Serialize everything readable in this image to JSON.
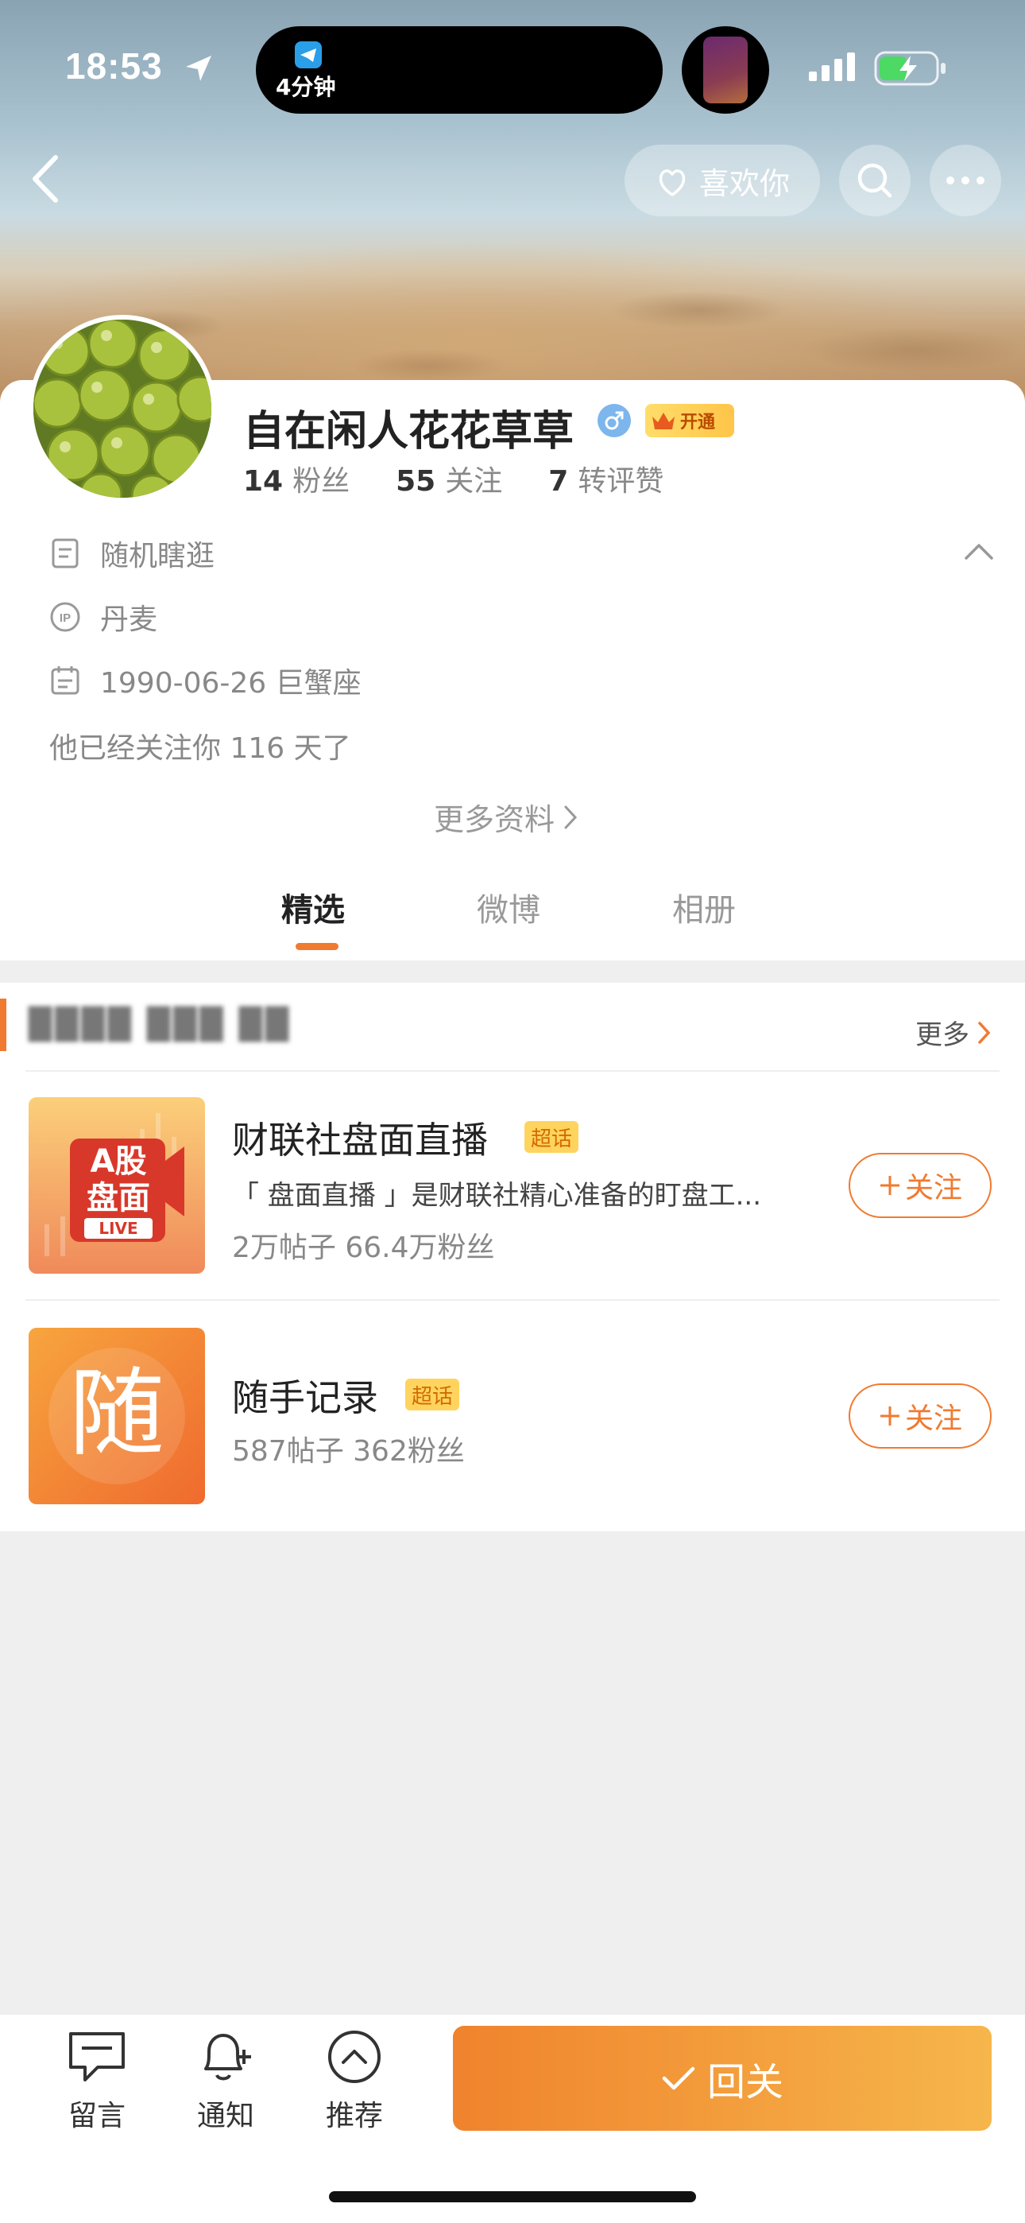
{
  "status_bar": {
    "time": "18:53",
    "island_text": "4分钟"
  },
  "header": {
    "like_label": "喜欢你"
  },
  "profile": {
    "name": "自在闲人花花草草",
    "vip_label": "开通",
    "stats": [
      {
        "value": "14",
        "label": "粉丝"
      },
      {
        "value": "55",
        "label": "关注"
      },
      {
        "value": "7",
        "label": "转评赞"
      }
    ],
    "bio": "随机瞎逛",
    "ip": "丹麦",
    "birthday": "1990-06-26 巨蟹座",
    "follow_days": "他已经关注你 116 天了",
    "more_info": "更多资料"
  },
  "tabs": [
    {
      "label": "精选",
      "active": true
    },
    {
      "label": "微博",
      "active": false
    },
    {
      "label": "相册",
      "active": false
    }
  ],
  "topics_section": {
    "title": "████ ███ ██",
    "more_label": "更多",
    "items": [
      {
        "thumb_line1": "A股",
        "thumb_line2": "盘面",
        "thumb_tag": "LIVE",
        "title": "财联社盘面直播",
        "badge": "超话",
        "desc": "「 盘面直播 」是财联社精心准备的盯盘工...",
        "meta": "2万帖子 66.4万粉丝",
        "follow_label": "关注"
      },
      {
        "thumb_char": "随",
        "title": "随手记录",
        "badge": "超话",
        "meta": "587帖子 362粉丝",
        "follow_label": "关注"
      }
    ]
  },
  "bottom_bar": {
    "comment_label": "留言",
    "notify_label": "通知",
    "recommend_label": "推荐",
    "return_follow_label": "回关"
  },
  "colors": {
    "accent": "#f07a30",
    "badge_bg": "#ffd45e",
    "male_badge": "#7cb6ec"
  }
}
